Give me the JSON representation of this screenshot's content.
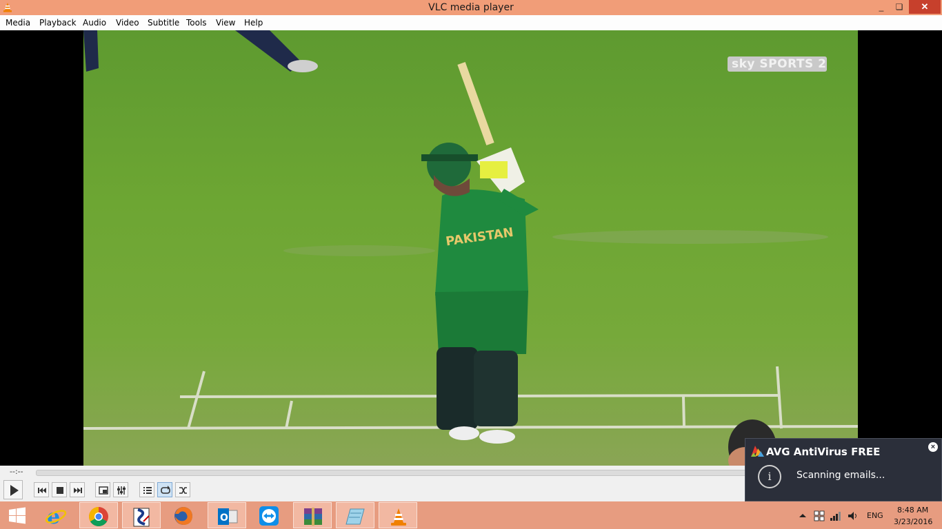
{
  "window": {
    "title": "VLC media player",
    "minimize": "_",
    "maximize": "❏",
    "close": "✕"
  },
  "menu": [
    "Media",
    "Playback",
    "Audio",
    "Video",
    "Subtitle",
    "Tools",
    "View",
    "Help"
  ],
  "video": {
    "channel_logo": "sky SPORTS 2",
    "shirt_text": "PAKISTAN"
  },
  "controls": {
    "elapsed": "--:--",
    "buttons": [
      "play-icon",
      "previous-icon",
      "stop-icon",
      "next-icon",
      "fullscreen-icon",
      "extended-settings-icon",
      "playlist-icon",
      "loop-icon",
      "random-icon"
    ]
  },
  "notification": {
    "brand": "AVG",
    "title": "AntiVirus FREE",
    "message": "Scanning emails...",
    "close": "×",
    "info": "i"
  },
  "taskbar": {
    "apps": [
      "windows-start-icon",
      "internet-explorer-icon",
      "chrome-icon",
      "app-icon",
      "firefox-icon",
      "outlook-icon",
      "teamviewer-icon",
      "winrar-icon",
      "notepad-icon",
      "vlc-icon"
    ],
    "language": "ENG",
    "time": "8:48 AM",
    "date": "3/23/2016"
  },
  "colors": {
    "titlebar": "#f19d78",
    "taskbar": "#e79c80",
    "close": "#c7402c",
    "vlc_orange": "#f08000"
  }
}
